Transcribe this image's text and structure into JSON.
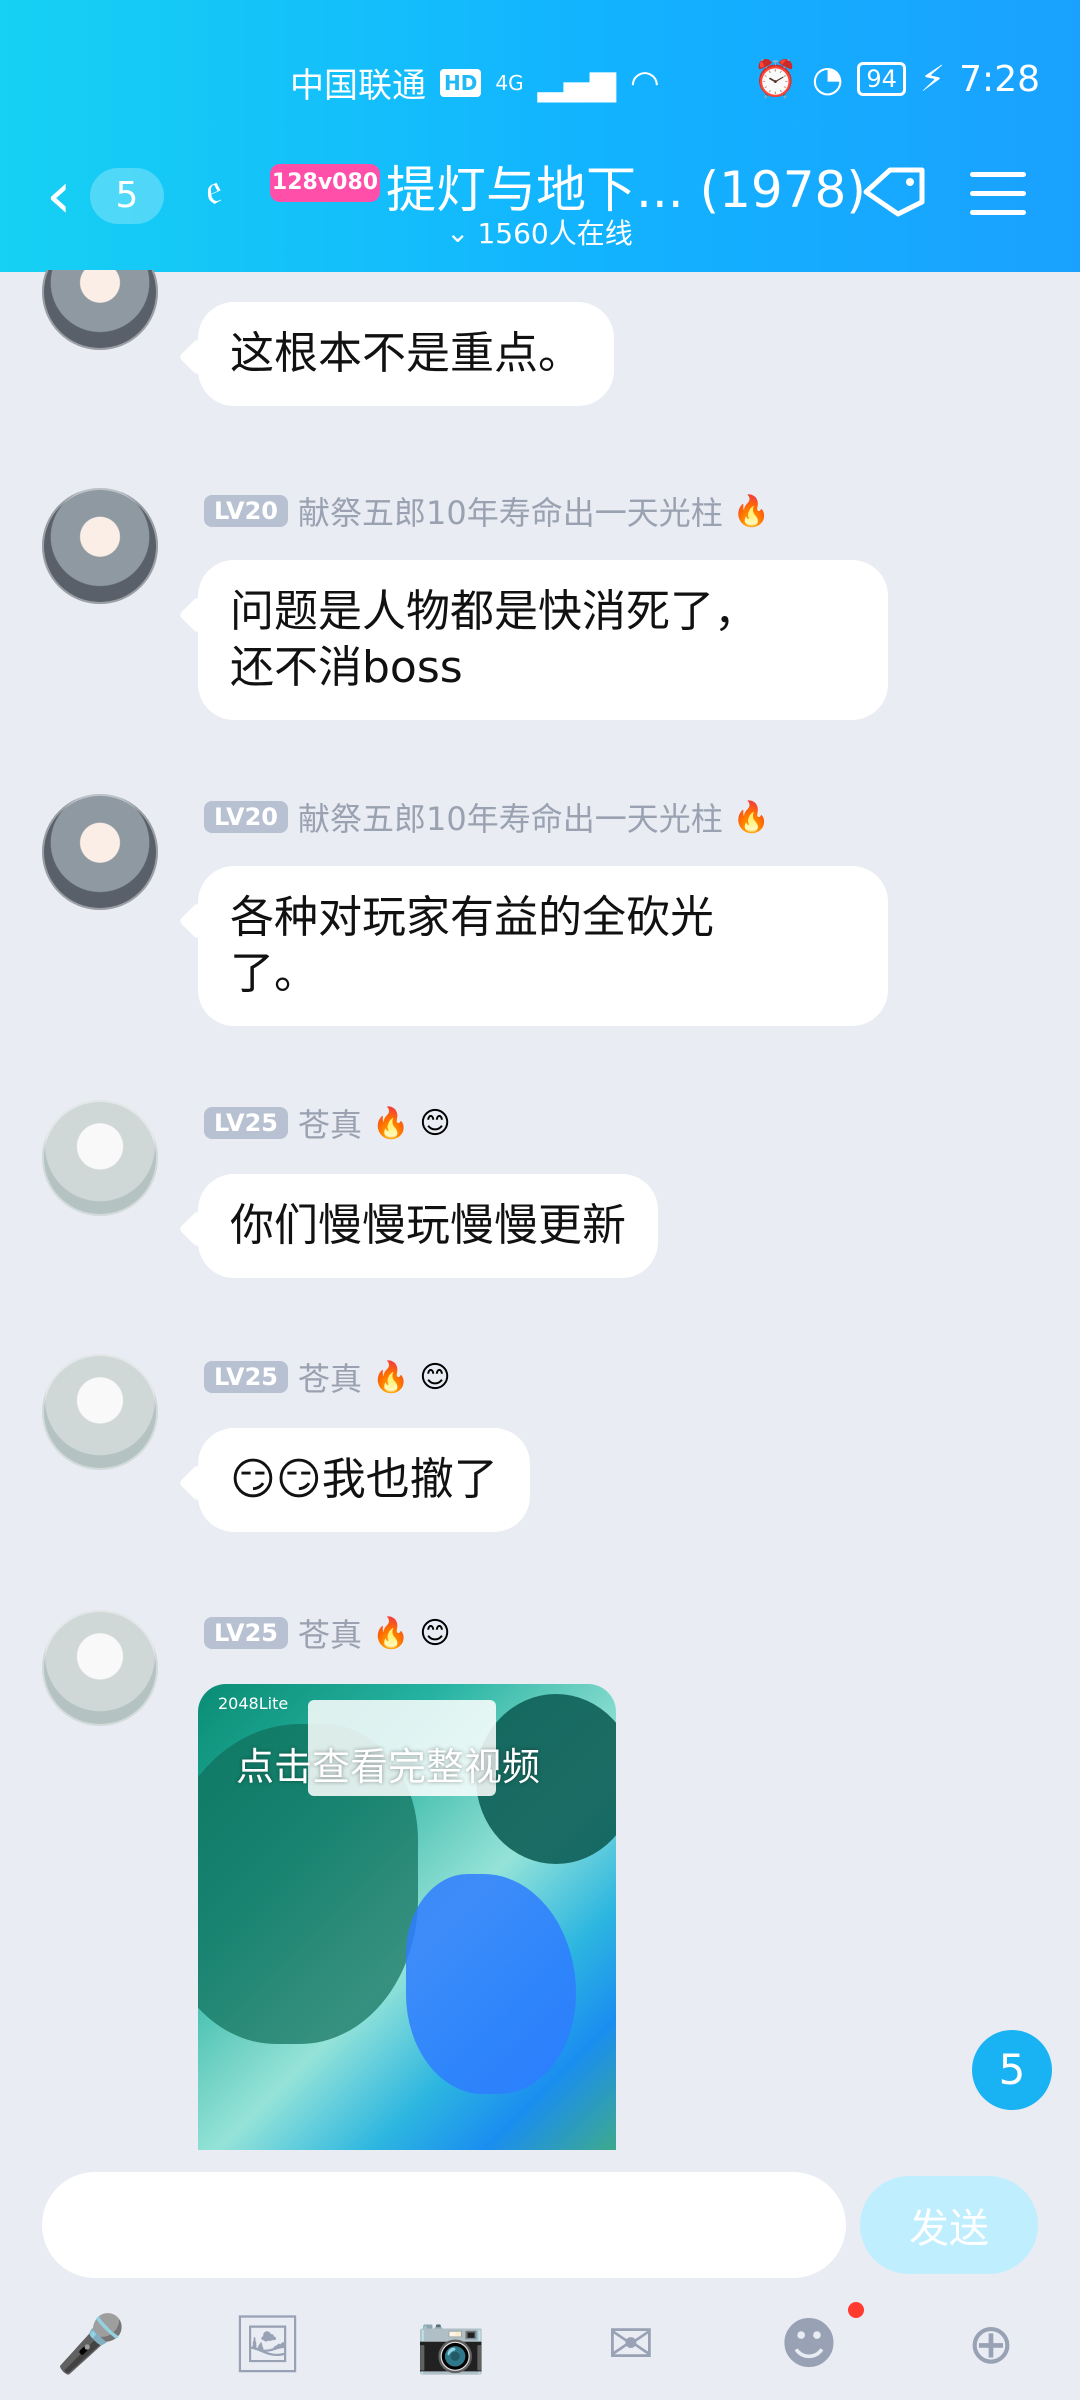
{
  "status_bar": {
    "carrier": "中国联通",
    "hd": "HD",
    "network": "4G",
    "battery": "94",
    "time": "7:28"
  },
  "header": {
    "back_count": "5",
    "badge": "128v080",
    "title": "提灯与地下... (1978)",
    "online": "1560人在线"
  },
  "messages": [
    {
      "text": "这根本不是重点。"
    },
    {
      "level": "LV20",
      "name": "献祭五郎10年寿命出一天光柱",
      "text": "问题是人物都是快消死了，\n还不消boss"
    },
    {
      "level": "LV20",
      "name": "献祭五郎10年寿命出一天光柱",
      "text": "各种对玩家有益的全砍光\n了。"
    },
    {
      "level": "LV25",
      "name": "苍真",
      "text": "你们慢慢玩慢慢更新"
    },
    {
      "level": "LV25",
      "name": "苍真",
      "text": "😏😏我也撤了"
    },
    {
      "level": "LV25",
      "name": "苍真",
      "video_overlay": "点击查看完整视频",
      "video_label": "2048Lite"
    }
  ],
  "floating_badge": "5",
  "input": {
    "placeholder": "",
    "send_label": "发送"
  },
  "colors": {
    "header_start": "#16d1f3",
    "header_end": "#1aa1ff",
    "accent": "#19b2f3"
  }
}
